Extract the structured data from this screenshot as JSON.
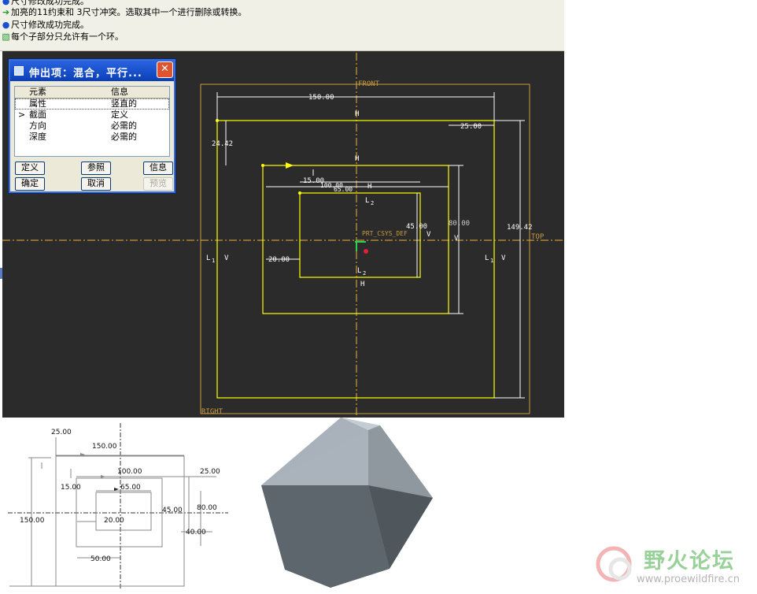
{
  "messages": [
    {
      "icon": "bullet",
      "text": "尺寸修改成功完成。"
    },
    {
      "icon": "arrow",
      "text": "加亮的11约束和 3尺寸冲突。选取其中一个进行删除或转换。"
    },
    {
      "icon": "bullet",
      "text": "尺寸修改成功完成。"
    },
    {
      "icon": "warning",
      "text": "每个子部分只允许有一个环。"
    }
  ],
  "dialog": {
    "title": "伸出项：混合，平行...",
    "close": "✕",
    "columns": [
      "元素",
      "信息"
    ],
    "rows": [
      {
        "marker": "",
        "element": "属性",
        "info": "竖直的"
      },
      {
        "marker": ">",
        "element": "截面",
        "info": "定义"
      },
      {
        "marker": "",
        "element": "方向",
        "info": "必需的"
      },
      {
        "marker": "",
        "element": "深度",
        "info": "必需的"
      }
    ],
    "buttons": {
      "define": "定义",
      "refs": "参照",
      "info": "信息",
      "ok": "确定",
      "cancel": "取消",
      "preview": "预览"
    }
  },
  "viewport": {
    "labels": {
      "front": "FRONT",
      "top": "TOP",
      "right": "RIGHT",
      "csys": "PRT_CSYS_DEF"
    },
    "dims": {
      "d150": "150.00",
      "d25": "25.00",
      "d24": "24.42",
      "d14942": "149.42",
      "d15": "15.00",
      "d100": "100.00",
      "d65": "65.00",
      "d45": "45.00",
      "d80": "80.00",
      "d20": "20.00"
    },
    "constraints": {
      "h": "H",
      "v": "V",
      "l1": "L",
      "l2": "L",
      "sub1": "1",
      "sub2": "2"
    }
  },
  "drawing": {
    "d25": "25.00",
    "d150": "150.00",
    "d100": "100.00",
    "d25b": "25.00",
    "d15": "15.00",
    "d65": "65.00",
    "d80": "80.00",
    "d45": "45.00",
    "d150v": "150.00",
    "d20": "20.00",
    "d40": "40.00",
    "d50": "50.00"
  },
  "logo": {
    "brand": "野火论坛",
    "url": "www.proewildfire.cn"
  },
  "colors": {
    "viewport_bg": "#2b2b2b",
    "sketch": "#ffff00",
    "datum": "#c89b3c",
    "dim": "#ffffff",
    "titlebar": "#0b3fb8"
  }
}
